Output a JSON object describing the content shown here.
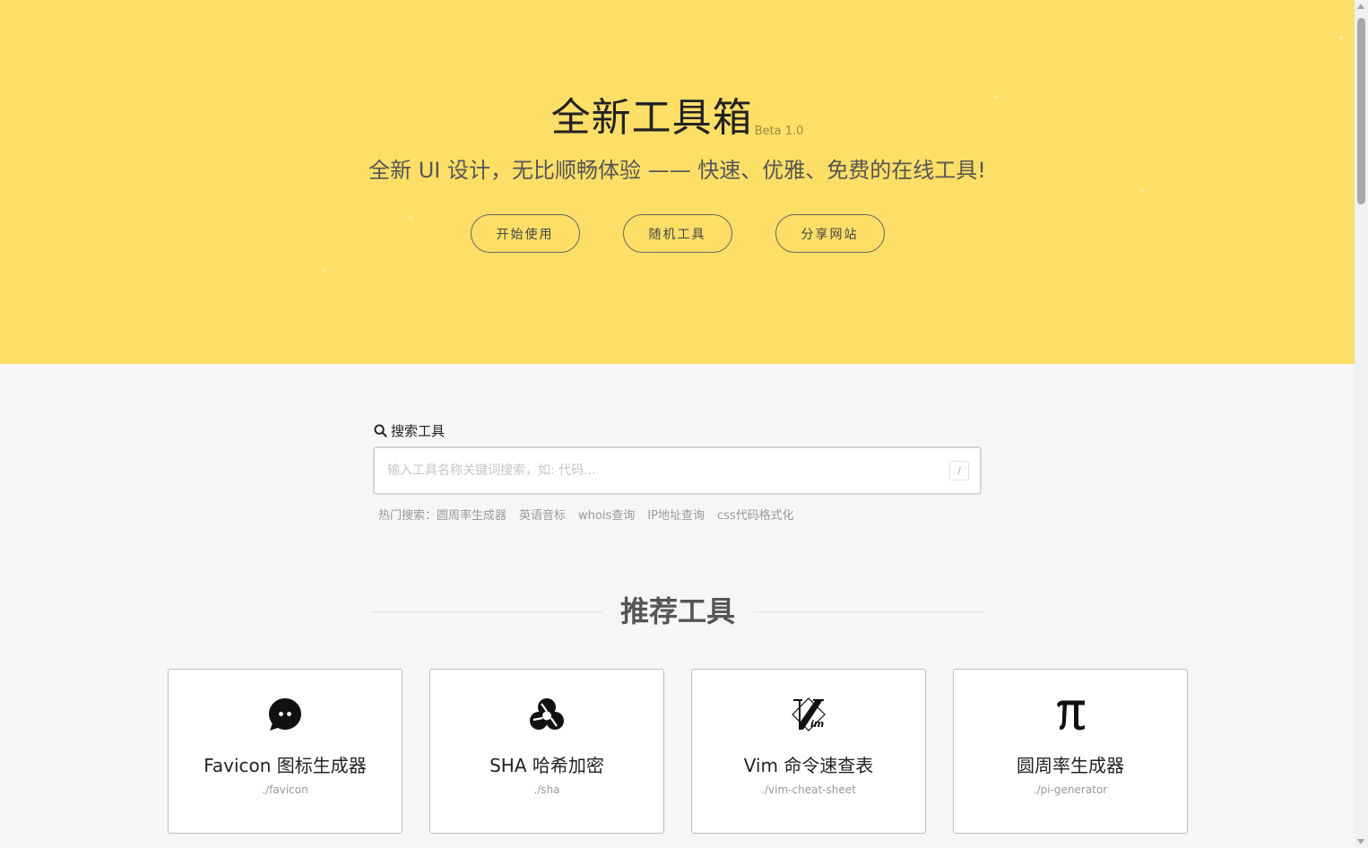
{
  "hero": {
    "title": "全新工具箱",
    "beta": "Beta 1.0",
    "subtitle": "全新 UI 设计，无比顺畅体验 —— 快速、优雅、免费的在线工具!",
    "buttons": {
      "start": "开始使用",
      "random": "随机工具",
      "share": "分享网站"
    },
    "background_color": "#fddf67"
  },
  "search": {
    "label": "搜索工具",
    "placeholder": "输入工具名称关键词搜索，如: 代码...",
    "value": "",
    "shortcut": "/",
    "hot_prefix": "热门搜索：",
    "hot_items": [
      "圆周率生成器",
      "英语音标",
      "whois查询",
      "IP地址查询",
      "css代码格式化"
    ]
  },
  "recommended": {
    "title": "推荐工具",
    "cards": [
      {
        "icon": "chat-bubble-icon",
        "title": "Favicon 图标生成器",
        "path": "./favicon"
      },
      {
        "icon": "sha-swirl-icon",
        "title": "SHA 哈希加密",
        "path": "./sha"
      },
      {
        "icon": "vim-logo-icon",
        "title": "Vim 命令速查表",
        "path": "./vim-cheat-sheet"
      },
      {
        "icon": "pi-icon",
        "title": "圆周率生成器",
        "path": "./pi-generator"
      }
    ]
  }
}
